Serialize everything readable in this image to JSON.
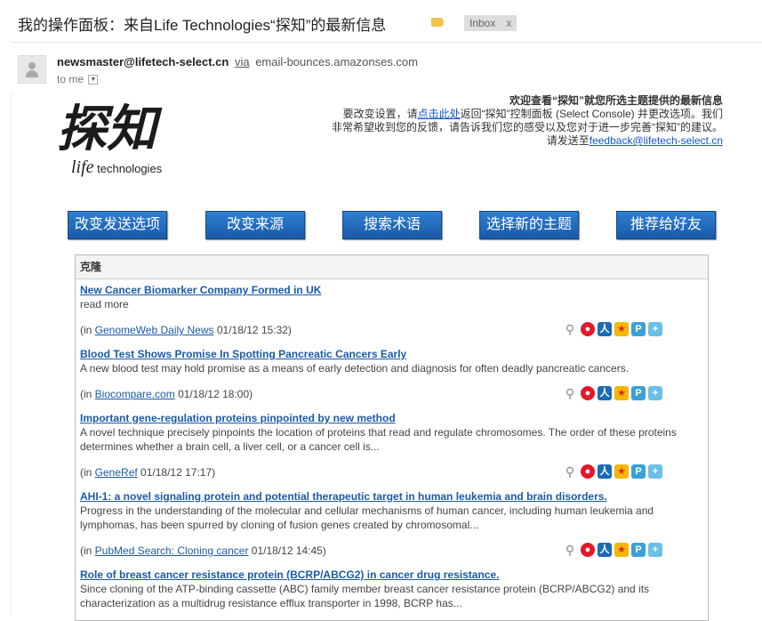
{
  "header": {
    "subject": "我的操作面板：来自Life Technologies“探知”的最新信息",
    "inbox_label": "Inbox",
    "inbox_close": "x"
  },
  "sender": {
    "address": "newsmaster@lifetech-select.cn",
    "via_label": "via",
    "via_domain": "email-bounces.amazonses.com",
    "to_me": "to me"
  },
  "logo": {
    "chinese": "探知",
    "life": "life",
    "tech": "technologies"
  },
  "welcome": {
    "title": "欢迎查看“探知”就您所选主题提供的最新信息",
    "line1_pre": "要改变设置，请",
    "line1_link": "点击此处",
    "line1_post": "返回“探知”控制面板 (Select Console) 并更改选项。我们",
    "line2": "非常希望收到您的反馈，请告诉我们您的感受以及您对于进一步完善“探知”的建议。",
    "line3_pre": "请发送至",
    "line3_link": "feedback@lifetech-select.cn"
  },
  "buttons": [
    "改变发送选项",
    "改变来源",
    "搜索术语",
    "选择新的主题",
    "推荐给好友"
  ],
  "panel": {
    "heading": "克隆",
    "items": [
      {
        "title": "New Cancer Biomarker Company Formed in UK",
        "desc": " read more",
        "source": "GenomeWeb Daily News",
        "date": "01/18/12 15:32"
      },
      {
        "title": "Blood Test Shows Promise In Spotting Pancreatic Cancers Early",
        "desc": "A new blood test may hold promise as a means of early detection and diagnosis for often deadly pancreatic cancers.",
        "source": "Biocompare.com",
        "date": "01/18/12 18:00"
      },
      {
        "title": "Important gene-regulation proteins pinpointed by new method",
        "desc": "A novel technique precisely pinpoints the location of proteins that read and regulate chromosomes. The order of these proteins determines whether a brain cell, a liver cell, or a cancer cell is...",
        "source": "GeneRef",
        "date": "01/18/12 17:17"
      },
      {
        "title": "AHI-1: a novel signaling protein and potential therapeutic target in human leukemia and brain disorders.",
        "desc": "Progress in the understanding of the molecular and cellular mechanisms of human cancer, including human leukemia and lymphomas, has been spurred by cloning of fusion genes created by chromosomal...",
        "source": "PubMed Search: Cloning cancer",
        "date": "01/18/12 14:45"
      },
      {
        "title": "Role of breast cancer resistance protein (BCRP/ABCG2) in cancer drug resistance.",
        "desc": "Since cloning of the ATP-binding cassette (ABC) family member breast cancer resistance protein (BCRP/ABCG2) and its characterization as a multidrug resistance efflux transporter in 1998, BCRP has...",
        "source": "",
        "date": ""
      }
    ]
  },
  "share_icons": [
    "attachment-icon",
    "weibo-icon",
    "renren-icon",
    "kaixin-icon",
    "douban-icon",
    "share-plus-icon"
  ],
  "colors": {
    "button_blue": "#1a5aa8",
    "link_blue": "#1155cc"
  }
}
